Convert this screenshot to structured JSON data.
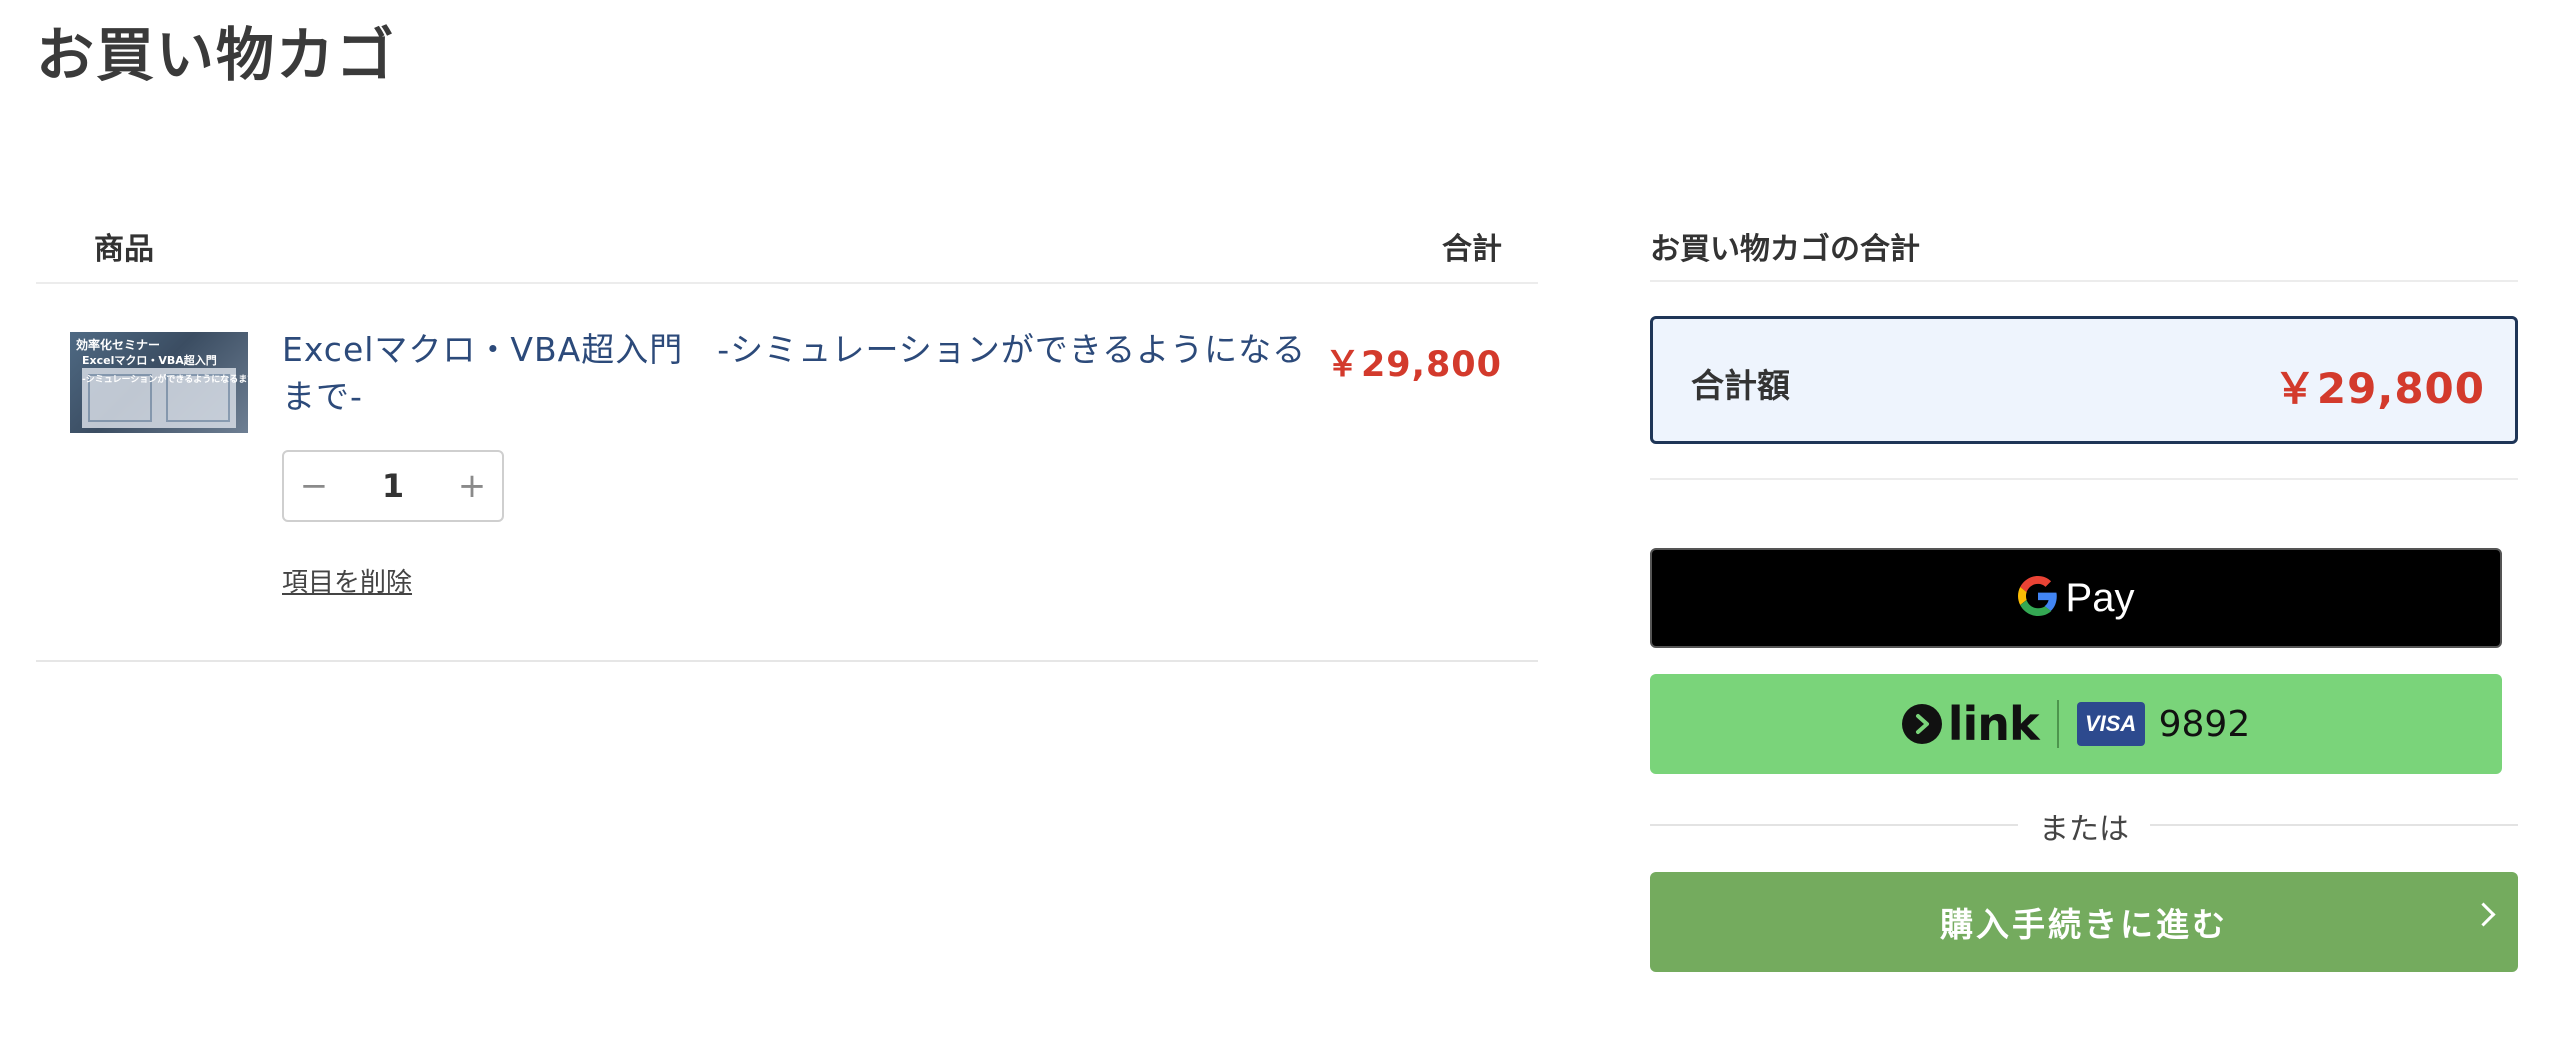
{
  "page": {
    "title": "お買い物カゴ"
  },
  "cart": {
    "headers": {
      "product": "商品",
      "total": "合計"
    },
    "items": [
      {
        "name": "Excelマクロ・VBA超入門　-シミュレーションができるようになるまで-",
        "price": "￥29,800",
        "quantity": "1",
        "remove_label": "項目を削除",
        "thumbnail_text": [
          "効率化セミナー",
          "Excelマクロ・VBA超入門",
          "-シミュレーションができるようになるまで-"
        ]
      }
    ],
    "qty_minus_symbol": "−",
    "qty_plus_symbol": "+"
  },
  "summary": {
    "title": "お買い物カゴの合計",
    "total_label": "合計額",
    "total_value": "￥29,800"
  },
  "payments": {
    "gpay_label": "Pay",
    "link_label": "link",
    "card_brand": "VISA",
    "card_last4": "9892",
    "or_text": "または",
    "checkout_label": "購入手続きに進む"
  },
  "colors": {
    "price": "#d33a2c",
    "product_link": "#2c4a7a",
    "total_box_border": "#1e3557",
    "total_box_bg": "#eef4fd",
    "link_button": "#7ad47a",
    "checkout_button": "#74ab5e"
  }
}
